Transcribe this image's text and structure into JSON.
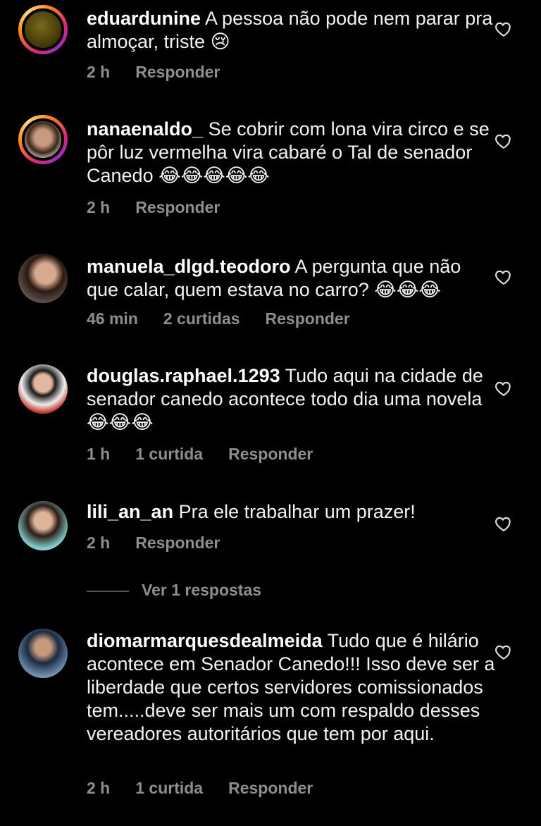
{
  "colors": {
    "background": "#000000",
    "text": "#f2f2f2",
    "meta": "#8e8e8e"
  },
  "comments": [
    {
      "username": "eduardunine",
      "text": "A pessoa não pode nem parar pra almoçar, triste",
      "emoji": "😢",
      "time": "2 h",
      "likes": "",
      "reply": "Responder",
      "avatar": "avatar",
      "heart": "heart-icon"
    },
    {
      "username": "nanaenaldo_",
      "text": "Se cobrir com lona vira circo e se pôr luz vermelha vira cabaré o Tal de senador Canedo",
      "emoji": "😂😂😂😂😂",
      "time": "2 h",
      "likes": "",
      "reply": "Responder",
      "avatar": "avatar",
      "heart": "heart-icon"
    },
    {
      "username": "manuela_dlgd.teodoro",
      "text": "A pergunta que não que calar, quem estava no carro?",
      "emoji": "😂😂😂",
      "time": "46 min",
      "likes": "2 curtidas",
      "reply": "Responder",
      "avatar": "avatar",
      "heart": "heart-icon"
    },
    {
      "username": "douglas.raphael.1293",
      "text": "Tudo aqui na cidade de senador canedo acontece  todo dia uma novela",
      "emoji": "😂😂😂",
      "time": "1 h",
      "likes": "1 curtida",
      "reply": "Responder",
      "avatar": "avatar",
      "heart": "heart-icon"
    },
    {
      "username": "lili_an_an",
      "text": "Pra ele trabalhar um prazer!",
      "emoji": "",
      "time": "2 h",
      "likes": "",
      "reply": "Responder",
      "avatar": "avatar",
      "heart": "heart-icon"
    },
    {
      "username": "diomarmarquesdealmeida",
      "text": "Tudo que é hilário acontece em Senador Canedo!!! Isso deve ser a liberdade que certos servidores comissionados tem.....deve ser mais um com respaldo desses vereadores autoritários que tem por aqui.",
      "emoji": "",
      "time": "2 h",
      "likes": "1 curtida",
      "reply": "Responder",
      "avatar": "avatar",
      "heart": "heart-icon"
    }
  ],
  "view_replies": "Ver 1 respostas"
}
